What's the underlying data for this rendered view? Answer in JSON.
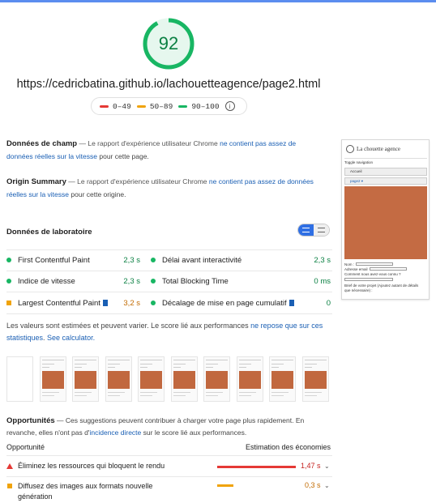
{
  "header": {
    "score": "92",
    "url": "https://cedricbatina.github.io/lachouetteagence/page2.html",
    "legend": [
      {
        "label": "0–49",
        "color": "#e53935"
      },
      {
        "label": "50–89",
        "color": "#f0a30a"
      },
      {
        "label": "90–100",
        "color": "#18b663"
      }
    ],
    "info_icon": "info-icon"
  },
  "field_data": {
    "title": "Données de champ",
    "dash": "— Le rapport d'expérience utilisateur Chrome",
    "link": "ne contient pas assez de données réelles sur la vitesse",
    "tail": "pour cette page."
  },
  "origin_summary": {
    "title": "Origin Summary",
    "dash": "— Le rapport d'expérience utilisateur Chrome",
    "link": "ne contient pas assez de données réelles sur la vitesse",
    "tail": "pour cette origine."
  },
  "lab": {
    "title": "Données de laboratoire",
    "metrics": [
      {
        "name": "First Contentful Paint",
        "value": "2,3 s"
      },
      {
        "name": "Délai avant interactivité",
        "value": "2,3 s"
      },
      {
        "name": "Indice de vitesse",
        "value": "2,3 s"
      },
      {
        "name": "Total Blocking Time",
        "value": "0 ms"
      },
      {
        "name": "Largest Contentful Paint",
        "value": "3,2 s"
      },
      {
        "name": "Décalage de mise en page cumulatif",
        "value": "0"
      }
    ],
    "note_text": "Les valeurs sont estimées et peuvent varier. Le score lié aux performances",
    "note_link": "ne repose que sur ces statistiques",
    "note_calc": "See calculator."
  },
  "opportunities": {
    "title": "Opportunités",
    "desc": "— Ces suggestions peuvent contribuer à charger votre page plus rapidement. En revanche, elles n'ont pas d'",
    "desc_link": "incidence directe",
    "desc_tail": "sur le score lié aux performances.",
    "col_left": "Opportunité",
    "col_right": "Estimation des économies",
    "items": [
      {
        "label": "Éliminez les ressources qui bloquent le rendu",
        "value": "1,47 s",
        "fraction": 0.97,
        "color": "#e53935"
      },
      {
        "label": "Diffusez des images aux formats nouvelle génération",
        "value": "0,3 s",
        "fraction": 0.2,
        "color": "#f0a30a"
      }
    ]
  },
  "preview": {
    "site_title": "La chouette agence",
    "toggle_nav": "Toggle navigation",
    "nav_home": "Accueil",
    "nav_page2": "page2 ▾",
    "form_name": "Nom :",
    "form_email": "Adresse email",
    "form_q": "Comment nous avez-vous connu ?",
    "form_brief": "Brief de votre projet (Ajoutez autant de détails que nécessaire) :"
  }
}
